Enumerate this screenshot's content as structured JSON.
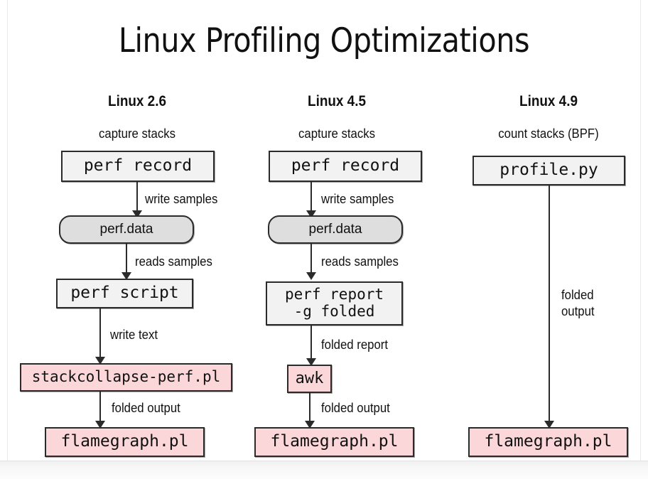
{
  "slide": {
    "title": "Linux Profiling Optimizations",
    "background_color": "#ffffff",
    "colors": {
      "command_box": "#f2f2f2",
      "data_box": "#dedede",
      "tool_box": "#fbd7d9",
      "stroke": "#2b2b2b",
      "text": "#111111"
    }
  },
  "columns": [
    {
      "title": "Linux 2.6",
      "subtitle": "capture stacks",
      "nodes": [
        {
          "label": "perf record",
          "kind": "cmd"
        },
        {
          "label": "perf.data",
          "kind": "data"
        },
        {
          "label": "perf script",
          "kind": "cmd"
        },
        {
          "label": "stackcollapse-perf.pl",
          "kind": "tool"
        },
        {
          "label": "flamegraph.pl",
          "kind": "tool"
        }
      ],
      "edges": [
        {
          "label": "write samples"
        },
        {
          "label": "reads samples"
        },
        {
          "label": "write text"
        },
        {
          "label": "folded output"
        }
      ]
    },
    {
      "title": "Linux 4.5",
      "subtitle": "capture stacks",
      "nodes": [
        {
          "label": "perf record",
          "kind": "cmd"
        },
        {
          "label": "perf.data",
          "kind": "data"
        },
        {
          "label": "perf report\n-g folded",
          "kind": "cmd"
        },
        {
          "label": "awk",
          "kind": "tool"
        },
        {
          "label": "flamegraph.pl",
          "kind": "tool"
        }
      ],
      "edges": [
        {
          "label": "write samples"
        },
        {
          "label": "reads samples"
        },
        {
          "label": "folded report"
        },
        {
          "label": "folded output"
        }
      ]
    },
    {
      "title": "Linux 4.9",
      "subtitle": "count stacks (BPF)",
      "nodes": [
        {
          "label": "profile.py",
          "kind": "cmd"
        },
        {
          "label": "flamegraph.pl",
          "kind": "tool"
        }
      ],
      "edges": [
        {
          "label": "folded\noutput"
        }
      ]
    }
  ]
}
